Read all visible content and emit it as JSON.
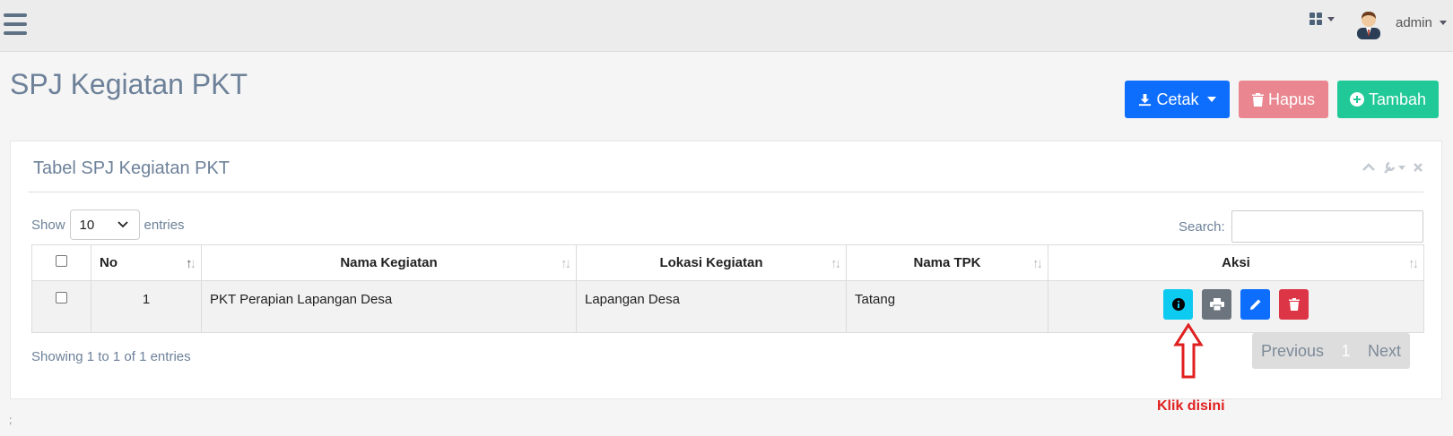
{
  "topbar": {
    "user_name": "admin"
  },
  "page": {
    "title": "SPJ Kegiatan PKT"
  },
  "actions": {
    "cetak": "Cetak",
    "hapus": "Hapus",
    "tambah": "Tambah"
  },
  "panel": {
    "title": "Tabel SPJ Kegiatan PKT"
  },
  "datatable": {
    "show_label": "Show",
    "entries_value": "10",
    "entries_label": "entries",
    "search_label": "Search:",
    "columns": [
      "No",
      "Nama Kegiatan",
      "Lokasi Kegiatan",
      "Nama TPK",
      "Aksi"
    ],
    "rows": [
      {
        "no": "1",
        "nama_kegiatan": "PKT Perapian Lapangan Desa",
        "lokasi": "Lapangan Desa",
        "nama_tpk": "Tatang"
      }
    ],
    "info": "Showing 1 to 1 of 1 entries",
    "pagination": {
      "previous": "Previous",
      "current": "1",
      "next": "Next"
    }
  },
  "annotation": {
    "text": "Klik disini"
  },
  "footer": {
    "text": ";"
  },
  "colors": {
    "primary": "#0d6efd",
    "danger_light": "#ea868f",
    "success": "#20c997",
    "info": "#0dcaf0",
    "secondary": "#6c757d",
    "danger": "#dc3545",
    "annotation": "#e01f1f"
  }
}
